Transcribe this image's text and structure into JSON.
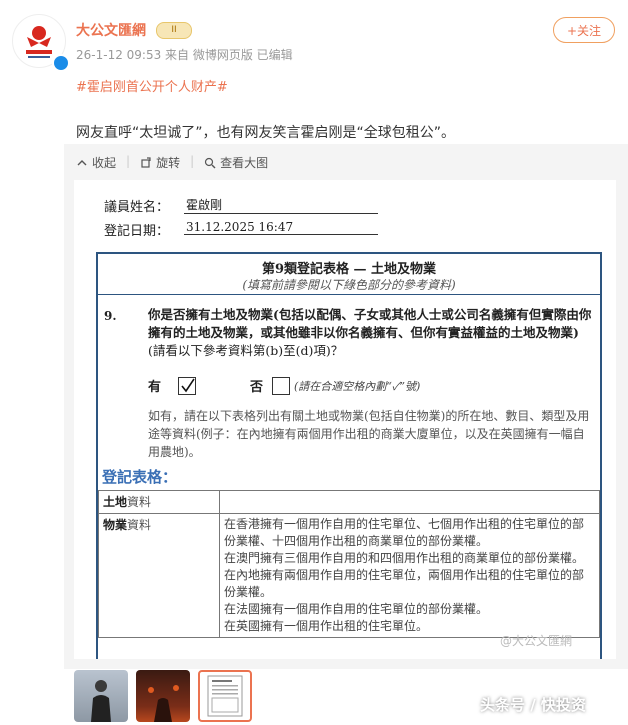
{
  "post": {
    "account_name": "大公文匯網",
    "badge": "II",
    "meta": "26-1-12 09:53 来自 微博网页版 已编辑",
    "follow_label": "+关注",
    "hashtag": "#霍启刚首公开个人财产#",
    "text": "网友直呼“太坦诚了”，也有网友笑言霍启刚是“全球包租公”。"
  },
  "toolbar": {
    "collect": "收起",
    "rotate": "旋转",
    "view_large": "查看大图"
  },
  "document": {
    "name_label": "議員姓名：",
    "name_value": "霍啟剛",
    "date_label": "登記日期：",
    "date_value": "31.12.2025 16:47",
    "form_title": "第9類登記表格 — 土地及物業",
    "form_subtitle": "(填寫前請參閱以下綠色部分的參考資料)",
    "q_number": "9.",
    "q_text": "你是否擁有土地及物業(包括以配偶、子女或其他人士或公司名義擁有但實際由你擁有的土地及物業，或其他雖非以你名義擁有、但你有實益權益的土地及物業)",
    "q_note": "(請看以下參考資料第(b)至(d)項)？",
    "yes_label": "有",
    "no_label": "否",
    "checkbox_note": "(請在合適空格內劃“✓”號)",
    "instruction": "如有，請在以下表格列出有關土地或物業(包括自住物業)的所在地、數目、類型及用途等資料(例子：在內地擁有兩個用作出租的商業大廈單位，以及在英國擁有一幅自用農地)。",
    "section_title": "登記表格：",
    "land_label_bold": "土地",
    "land_label_rest": "資料",
    "property_label_bold": "物業",
    "property_label_rest": "資料",
    "property_lines": [
      "在香港擁有一個用作自用的住宅單位、七個用作出租的住宅單位的部份業權、十四個用作出租的商業單位的部份業權。",
      "在澳門擁有三個用作自用的和四個用作出租的商業單位的部份業權。",
      "在內地擁有兩個用作自用的住宅單位，兩個用作出租的住宅單位的部份業權。",
      "在法國擁有一個用作自用的住宅單位的部份業權。",
      "在英國擁有一個用作出租的住宅單位。"
    ]
  },
  "watermark": "@大公文匯網",
  "corner_text": "头条号 / 快投资",
  "colors": {
    "accent": "#eb7350",
    "form_border": "#2d5580",
    "section_blue": "#3a6fb5"
  }
}
